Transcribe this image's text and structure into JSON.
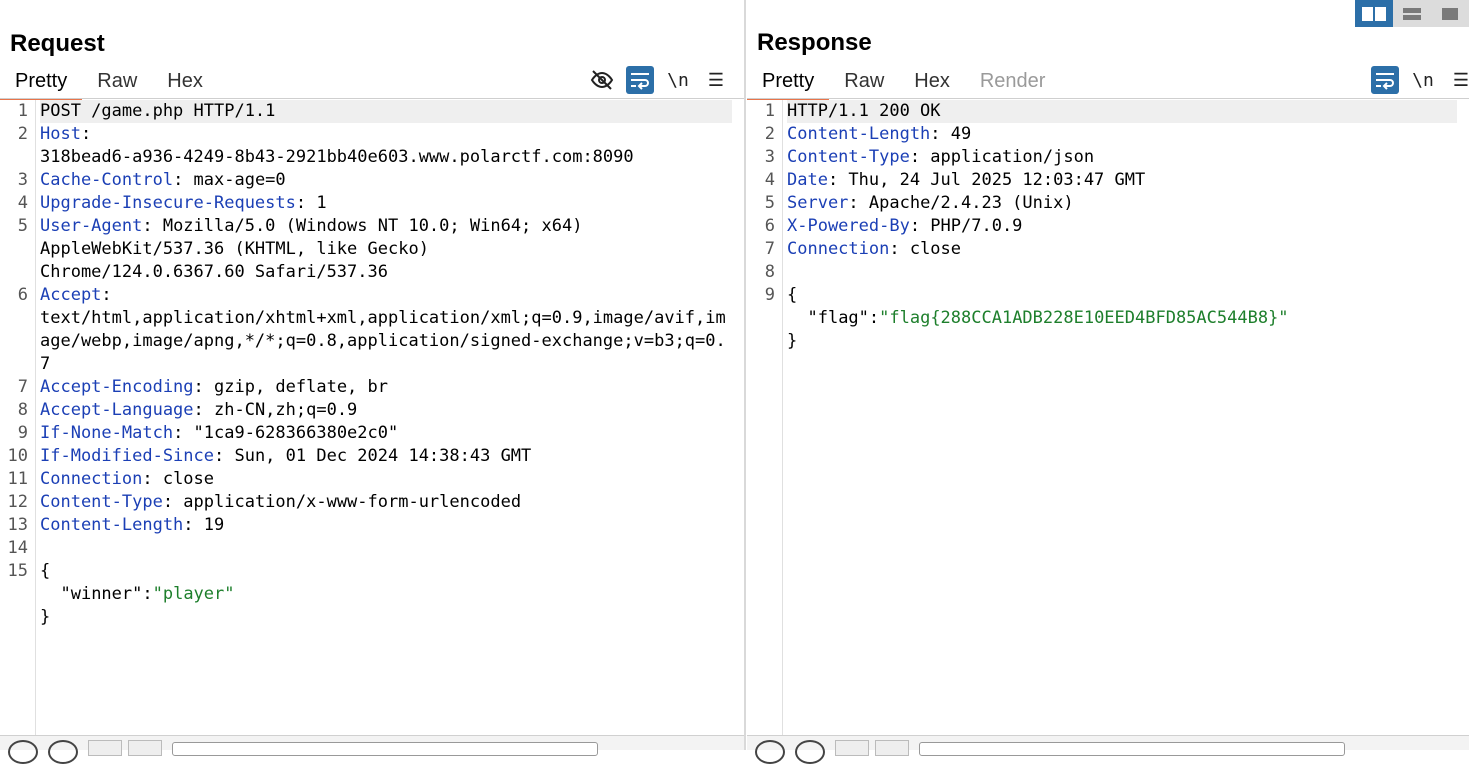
{
  "request": {
    "title": "Request",
    "tabs": [
      {
        "label": "Pretty",
        "active": true
      },
      {
        "label": "Raw"
      },
      {
        "label": "Hex"
      }
    ],
    "toolbar": {
      "icons": [
        "eye-slash-icon",
        "wrap-icon",
        "newline-icon",
        "menu-icon"
      ],
      "newline_label": "\\n",
      "menu_label": "☰"
    },
    "lines": [
      {
        "n": "1",
        "segments": [
          {
            "t": "POST /game.php HTTP/1.1",
            "c": ""
          }
        ],
        "hl": true
      },
      {
        "n": "2",
        "segments": [
          {
            "t": "Host",
            "c": "hdr"
          },
          {
            "t": ":\n318bead6-a936-4249-8b43-2921bb40e603.www.polarctf.com:8090",
            "c": ""
          }
        ]
      },
      {
        "n": "3",
        "segments": [
          {
            "t": "Cache-Control",
            "c": "hdr"
          },
          {
            "t": ": max-age=0",
            "c": ""
          }
        ]
      },
      {
        "n": "4",
        "segments": [
          {
            "t": "Upgrade-Insecure-Requests",
            "c": "hdr"
          },
          {
            "t": ": 1",
            "c": ""
          }
        ]
      },
      {
        "n": "5",
        "segments": [
          {
            "t": "User-Agent",
            "c": "hdr"
          },
          {
            "t": ": Mozilla/5.0 (Windows NT 10.0; Win64; x64)\nAppleWebKit/537.36 (KHTML, like Gecko)\nChrome/124.0.6367.60 Safari/537.36",
            "c": ""
          }
        ]
      },
      {
        "n": "6",
        "segments": [
          {
            "t": "Accept",
            "c": "hdr"
          },
          {
            "t": ":\ntext/html,application/xhtml+xml,application/xml;q=0.9,image/avif,image/webp,image/apng,*/*;q=0.8,application/signed-exchange;v=b3;q=0.7",
            "c": ""
          }
        ]
      },
      {
        "n": "7",
        "segments": [
          {
            "t": "Accept-Encoding",
            "c": "hdr"
          },
          {
            "t": ": gzip, deflate, br",
            "c": ""
          }
        ]
      },
      {
        "n": "8",
        "segments": [
          {
            "t": "Accept-Language",
            "c": "hdr"
          },
          {
            "t": ": zh-CN,zh;q=0.9",
            "c": ""
          }
        ]
      },
      {
        "n": "9",
        "segments": [
          {
            "t": "If-None-Match",
            "c": "hdr"
          },
          {
            "t": ": \"1ca9-628366380e2c0\"",
            "c": ""
          }
        ]
      },
      {
        "n": "10",
        "segments": [
          {
            "t": "If-Modified-Since",
            "c": "hdr"
          },
          {
            "t": ": Sun, 01 Dec 2024 14:38:43 GMT",
            "c": ""
          }
        ]
      },
      {
        "n": "11",
        "segments": [
          {
            "t": "Connection",
            "c": "hdr"
          },
          {
            "t": ": close",
            "c": ""
          }
        ]
      },
      {
        "n": "12",
        "segments": [
          {
            "t": "Content-Type",
            "c": "hdr"
          },
          {
            "t": ": application/x-www-form-urlencoded",
            "c": ""
          }
        ]
      },
      {
        "n": "13",
        "segments": [
          {
            "t": "Content-Length",
            "c": "hdr"
          },
          {
            "t": ": 19",
            "c": ""
          }
        ]
      },
      {
        "n": "14",
        "segments": [
          {
            "t": "",
            "c": ""
          }
        ]
      },
      {
        "n": "15",
        "segments": [
          {
            "t": "{\n  \"winner\":",
            "c": ""
          },
          {
            "t": "\"player\"",
            "c": "str"
          },
          {
            "t": "\n}",
            "c": ""
          }
        ]
      }
    ]
  },
  "response": {
    "title": "Response",
    "tabs": [
      {
        "label": "Pretty",
        "active": true
      },
      {
        "label": "Raw"
      },
      {
        "label": "Hex"
      },
      {
        "label": "Render",
        "disabled": true
      }
    ],
    "toolbar": {
      "icons": [
        "wrap-icon",
        "newline-icon",
        "menu-icon"
      ],
      "newline_label": "\\n",
      "menu_label": "☰"
    },
    "lines": [
      {
        "n": "1",
        "segments": [
          {
            "t": "HTTP/1.1 200 OK",
            "c": ""
          }
        ],
        "hl": true
      },
      {
        "n": "2",
        "segments": [
          {
            "t": "Content-Length",
            "c": "hdr"
          },
          {
            "t": ": 49",
            "c": ""
          }
        ]
      },
      {
        "n": "3",
        "segments": [
          {
            "t": "Content-Type",
            "c": "hdr"
          },
          {
            "t": ": application/json",
            "c": ""
          }
        ]
      },
      {
        "n": "4",
        "segments": [
          {
            "t": "Date",
            "c": "hdr"
          },
          {
            "t": ": Thu, 24 Jul 2025 12:03:47 GMT",
            "c": ""
          }
        ]
      },
      {
        "n": "5",
        "segments": [
          {
            "t": "Server",
            "c": "hdr"
          },
          {
            "t": ": Apache/2.4.23 (Unix)",
            "c": ""
          }
        ]
      },
      {
        "n": "6",
        "segments": [
          {
            "t": "X-Powered-By",
            "c": "hdr"
          },
          {
            "t": ": PHP/7.0.9",
            "c": ""
          }
        ]
      },
      {
        "n": "7",
        "segments": [
          {
            "t": "Connection",
            "c": "hdr"
          },
          {
            "t": ": close",
            "c": ""
          }
        ]
      },
      {
        "n": "8",
        "segments": [
          {
            "t": "",
            "c": ""
          }
        ]
      },
      {
        "n": "9",
        "segments": [
          {
            "t": "{\n  \"flag\":",
            "c": ""
          },
          {
            "t": "\"flag{288CCA1ADB228E10EED4BFD85AC544B8}\"",
            "c": "str"
          },
          {
            "t": "\n}",
            "c": ""
          }
        ]
      }
    ]
  },
  "layout_switch": [
    "split-horizontal-icon",
    "split-vertical-icon",
    "single-pane-icon"
  ],
  "colors": {
    "accent": "#2c6fa8",
    "tab_underline": "#e8744a",
    "header_name": "#1b3fb5",
    "string": "#1e7f2c"
  }
}
